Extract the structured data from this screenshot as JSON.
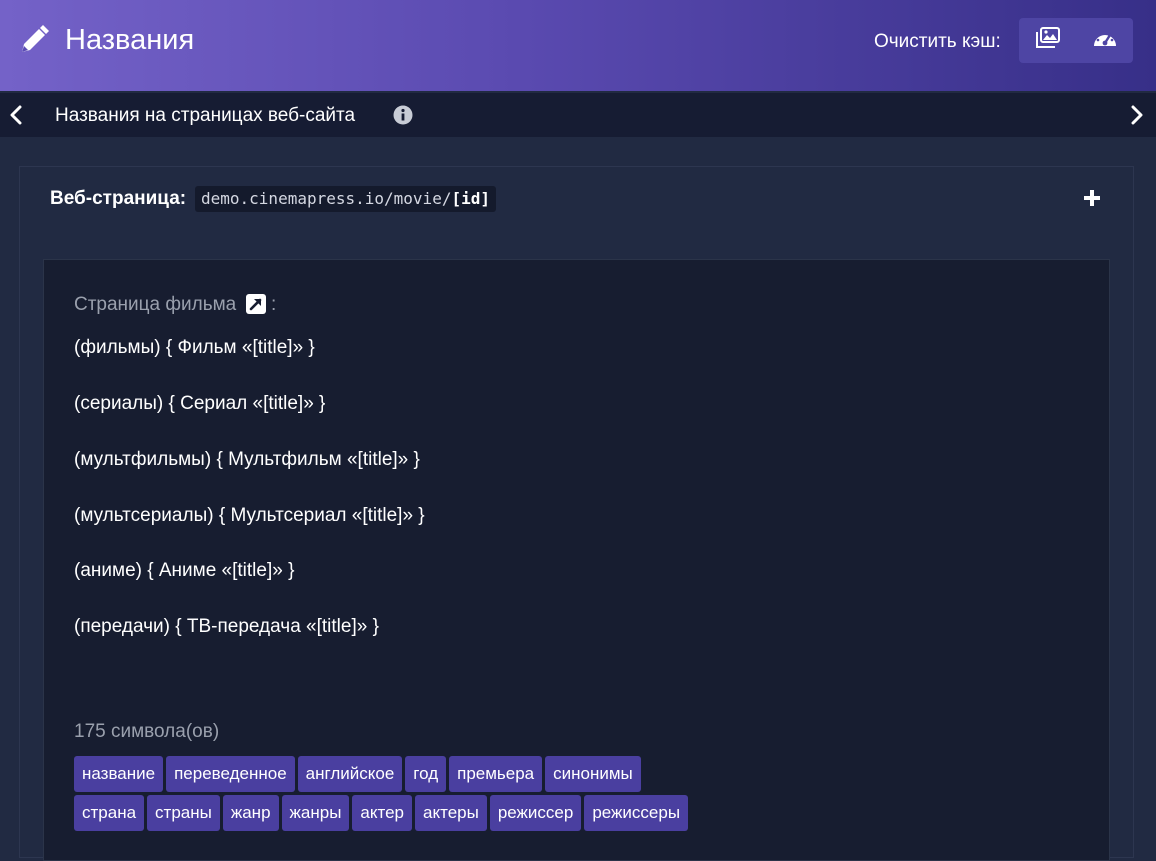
{
  "header": {
    "title": "Названия",
    "icon": "pencil-icon",
    "cache_label": "Очистить кэш:",
    "cache_buttons": [
      {
        "icon": "images-icon"
      },
      {
        "icon": "speedometer-icon"
      }
    ],
    "gradient": [
      "#7462c8",
      "#372f88"
    ]
  },
  "subnav": {
    "label": "Названия на страницах веб-сайта",
    "prev_icon": "chevron-left-icon",
    "next_icon": "chevron-right-icon",
    "info_icon": "info-icon"
  },
  "section": {
    "web_label": "Веб-страница:",
    "url_prefix": "demo.cinemapress.io/movie/",
    "url_param": "[id]",
    "add_icon": "plus-icon"
  },
  "field": {
    "label": "Страница фильма",
    "link_icon": "external-link-icon",
    "colon": ":",
    "lines": [
      "(фильмы) { Фильм «[title]» }",
      "(сериалы) { Сериал «[title]» }",
      "(мультфильмы) { Мультфильм «[title]» }",
      "(мультсериалы) { Мультсериал «[title]» }",
      "(аниме) { Аниме «[title]» }",
      "(передачи) { ТВ-передача «[title]» }"
    ],
    "char_count": "175 символа(ов)"
  },
  "tags": {
    "row1": [
      "название",
      "переведенное",
      "английское",
      "год",
      "премьера",
      "синонимы"
    ],
    "row2": [
      "страна",
      "страны",
      "жанр",
      "жанры",
      "актер",
      "актеры",
      "режиссер",
      "режиссеры"
    ]
  },
  "colors": {
    "background": "#212a42",
    "subnav": "#161c33",
    "editor": "#171d30",
    "tag": "#4a3fa0",
    "muted_text": "#9aa0ad"
  }
}
